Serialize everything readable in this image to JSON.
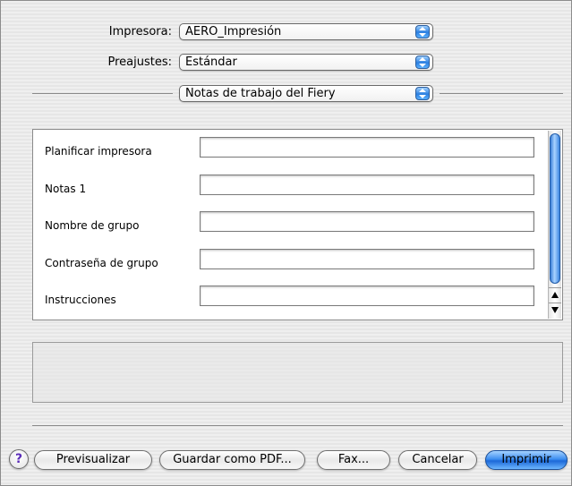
{
  "printer": {
    "label": "Impresora:",
    "value": "AERO_Impresión"
  },
  "presets": {
    "label": "Preajustes:",
    "value": "Estándar"
  },
  "section": {
    "value": "Notas de trabajo del Fiery"
  },
  "fields": [
    {
      "label": "Planificar impresora",
      "value": ""
    },
    {
      "label": "Notas 1",
      "value": ""
    },
    {
      "label": "Nombre de grupo",
      "value": ""
    },
    {
      "label": "Contraseña de grupo",
      "value": ""
    },
    {
      "label": "Instrucciones",
      "value": ""
    }
  ],
  "help": {
    "label": "?"
  },
  "buttons": {
    "preview": "Previsualizar",
    "save_pdf": "Guardar como PDF...",
    "fax": "Fax...",
    "cancel": "Cancelar",
    "print": "Imprimir"
  },
  "colors": {
    "accent": "#3d8ef0",
    "window_bg": "#ececec"
  },
  "icons": {
    "popup_arrows": "up-down-arrows-icon",
    "help": "help-icon",
    "scroll_up": "scroll-up-arrow-icon",
    "scroll_down": "scroll-down-arrow-icon"
  }
}
